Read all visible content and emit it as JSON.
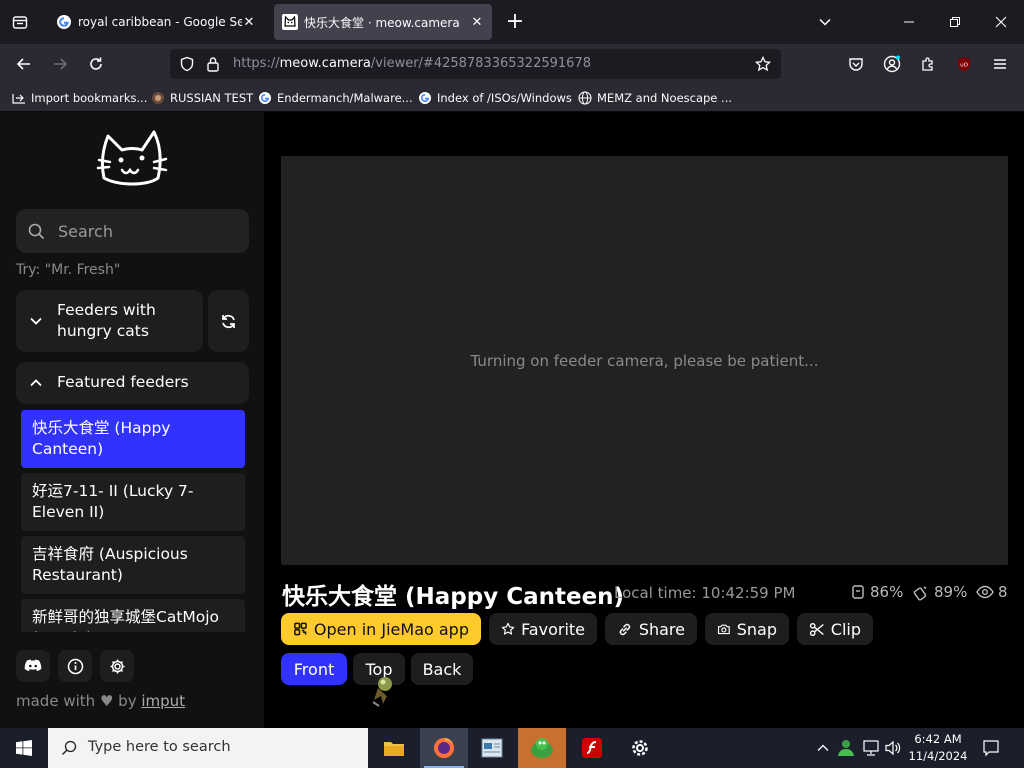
{
  "browser": {
    "tabs": [
      {
        "title": "royal caribbean - Google Search",
        "close": "✕"
      },
      {
        "title": "快乐大食堂 · meow.camera",
        "close": "✕"
      }
    ],
    "new_tab": "+",
    "url_prefix": "https://",
    "url_host": "meow.camera",
    "url_path": "/viewer/#4258783365322591678",
    "bookmarks": [
      "Import bookmarks...",
      "RUSSIAN TEST",
      "Endermanch/Malware...",
      "Index of /ISOs/Windows",
      "MEMZ and Noescape ..."
    ]
  },
  "sidebar": {
    "search_placeholder": "Search",
    "hint": "Try: \"Mr. Fresh\"",
    "group_hungry": "Feeders with hungry cats",
    "group_featured": "Featured feeders",
    "feeders": [
      "快乐大食堂 (Happy Canteen)",
      "好运7-11- II (Lucky 7-Eleven II)",
      "吉祥食府 (Auspicious Restaurant)",
      "新鲜哥的独享城堡CatMojo (Castle)"
    ],
    "made_with": "made with",
    "by": "by",
    "author": "imput"
  },
  "viewer": {
    "status_msg": "Turning on feeder camera, please be patient...",
    "title": "快乐大食堂 (Happy Canteen)",
    "local_time": "Local time: 10:42:59 PM",
    "food_pct": "86%",
    "battery_pct": "89%",
    "viewers": "8",
    "actions": {
      "open_app": "Open in JieMao app",
      "favorite": "Favorite",
      "share": "Share",
      "snap": "Snap",
      "clip": "Clip"
    },
    "views": [
      "Front",
      "Top",
      "Back"
    ]
  },
  "taskbar": {
    "search_text": "Type here to search",
    "time": "6:42 AM",
    "date": "11/4/2024"
  },
  "colors": {
    "accent_blue": "#3232ff",
    "accent_yellow": "#ffca2c"
  }
}
